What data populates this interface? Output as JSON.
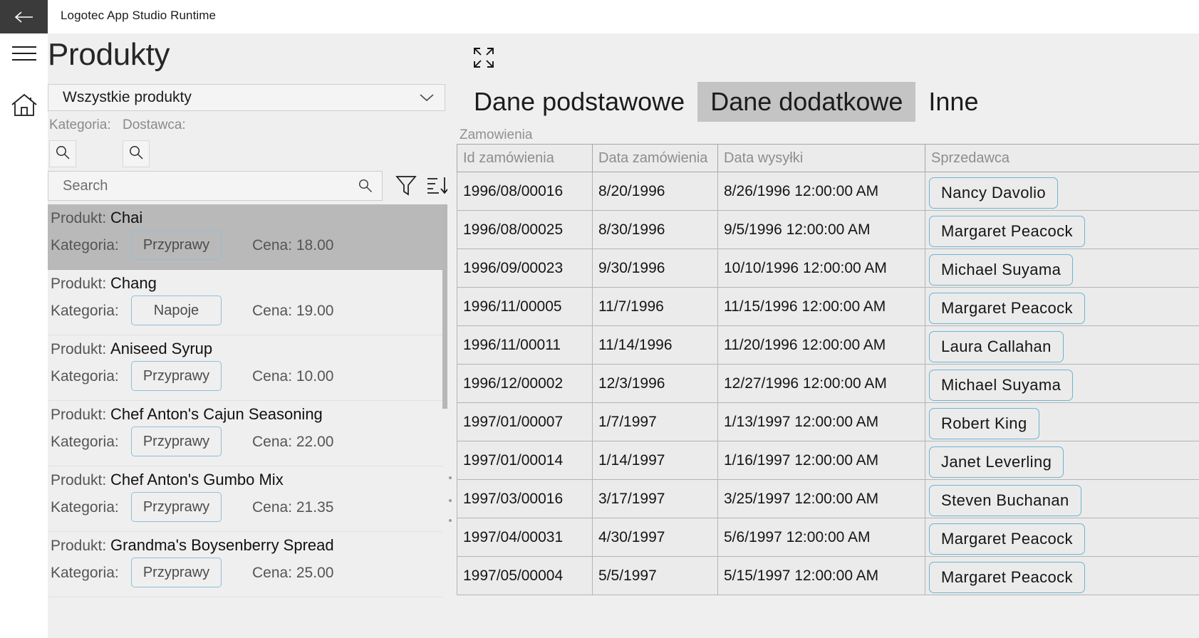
{
  "window": {
    "back_icon": "back-arrow-icon",
    "app_title": "Logotec App Studio Runtime"
  },
  "rail": {
    "menu_icon": "hamburger-menu-icon",
    "home_icon": "home-icon"
  },
  "left_panel": {
    "page_title": "Produkty",
    "combobox": {
      "value": "Wszystkie produkty",
      "chevron_icon": "chevron-down-icon"
    },
    "filters": {
      "kategoria_label": "Kategoria:",
      "dostawca_label": "Dostawca:",
      "kategoria_search_icon": "search-icon",
      "dostawca_search_icon": "search-icon"
    },
    "search": {
      "placeholder": "Search",
      "value": "",
      "icon": "search-icon"
    },
    "tools": {
      "filter_icon": "filter-funnel-icon",
      "sort_icon": "sort-descending-icon"
    },
    "row_labels": {
      "product": "Produkt:",
      "category": "Kategoria:",
      "price": "Cena:"
    },
    "products": [
      {
        "name": "Chai",
        "category": "Przyprawy",
        "price": "18.00",
        "selected": true
      },
      {
        "name": "Chang",
        "category": "Napoje",
        "price": "19.00",
        "selected": false
      },
      {
        "name": "Aniseed Syrup",
        "category": "Przyprawy",
        "price": "10.00",
        "selected": false
      },
      {
        "name": "Chef Anton's Cajun Seasoning",
        "category": "Przyprawy",
        "price": "22.00",
        "selected": false
      },
      {
        "name": "Chef Anton's Gumbo Mix",
        "category": "Przyprawy",
        "price": "21.35",
        "selected": false
      },
      {
        "name": "Grandma's Boysenberry Spread",
        "category": "Przyprawy",
        "price": "25.00",
        "selected": false
      }
    ]
  },
  "right_panel": {
    "expand_icon": "expand-fullscreen-icon",
    "tabs": [
      {
        "label": "Dane podstawowe",
        "active": false
      },
      {
        "label": "Dane dodatkowe",
        "active": true
      },
      {
        "label": "Inne",
        "active": false
      }
    ],
    "grid_caption": "Zamowienia",
    "columns": [
      "Id zamówienia",
      "Data zamówienia",
      "Data wysyłki",
      "Sprzedawca"
    ],
    "rows": [
      {
        "id": "1996/08/00016",
        "order_date": "8/20/1996",
        "ship_date": "8/26/1996 12:00:00 AM",
        "seller": "Nancy  Davolio"
      },
      {
        "id": "1996/08/00025",
        "order_date": "8/30/1996",
        "ship_date": "9/5/1996 12:00:00 AM",
        "seller": "Margaret  Peacock"
      },
      {
        "id": "1996/09/00023",
        "order_date": "9/30/1996",
        "ship_date": "10/10/1996 12:00:00 AM",
        "seller": "Michael  Suyama"
      },
      {
        "id": "1996/11/00005",
        "order_date": "11/7/1996",
        "ship_date": "11/15/1996 12:00:00 AM",
        "seller": "Margaret  Peacock"
      },
      {
        "id": "1996/11/00011",
        "order_date": "11/14/1996",
        "ship_date": "11/20/1996 12:00:00 AM",
        "seller": "Laura  Callahan"
      },
      {
        "id": "1996/12/00002",
        "order_date": "12/3/1996",
        "ship_date": "12/27/1996 12:00:00 AM",
        "seller": "Michael  Suyama"
      },
      {
        "id": "1997/01/00007",
        "order_date": "1/7/1997",
        "ship_date": "1/13/1997 12:00:00 AM",
        "seller": "Robert  King"
      },
      {
        "id": "1997/01/00014",
        "order_date": "1/14/1997",
        "ship_date": "1/16/1997 12:00:00 AM",
        "seller": "Janet  Leverling"
      },
      {
        "id": "1997/03/00016",
        "order_date": "3/17/1997",
        "ship_date": "3/25/1997 12:00:00 AM",
        "seller": "Steven  Buchanan"
      },
      {
        "id": "1997/04/00031",
        "order_date": "4/30/1997",
        "ship_date": "5/6/1997 12:00:00 AM",
        "seller": "Margaret  Peacock"
      },
      {
        "id": "1997/05/00004",
        "order_date": "5/5/1997",
        "ship_date": "5/15/1997 12:00:00 AM",
        "seller": "Margaret  Peacock"
      }
    ]
  },
  "colors": {
    "titlebar_back": "#3b3b3b",
    "panel_bg": "#efefef",
    "selection": "#b9b9b9",
    "tab_active": "#c4c4c4",
    "pill_border": "#6fb3d2",
    "grid_cell": "#ebebeb"
  }
}
